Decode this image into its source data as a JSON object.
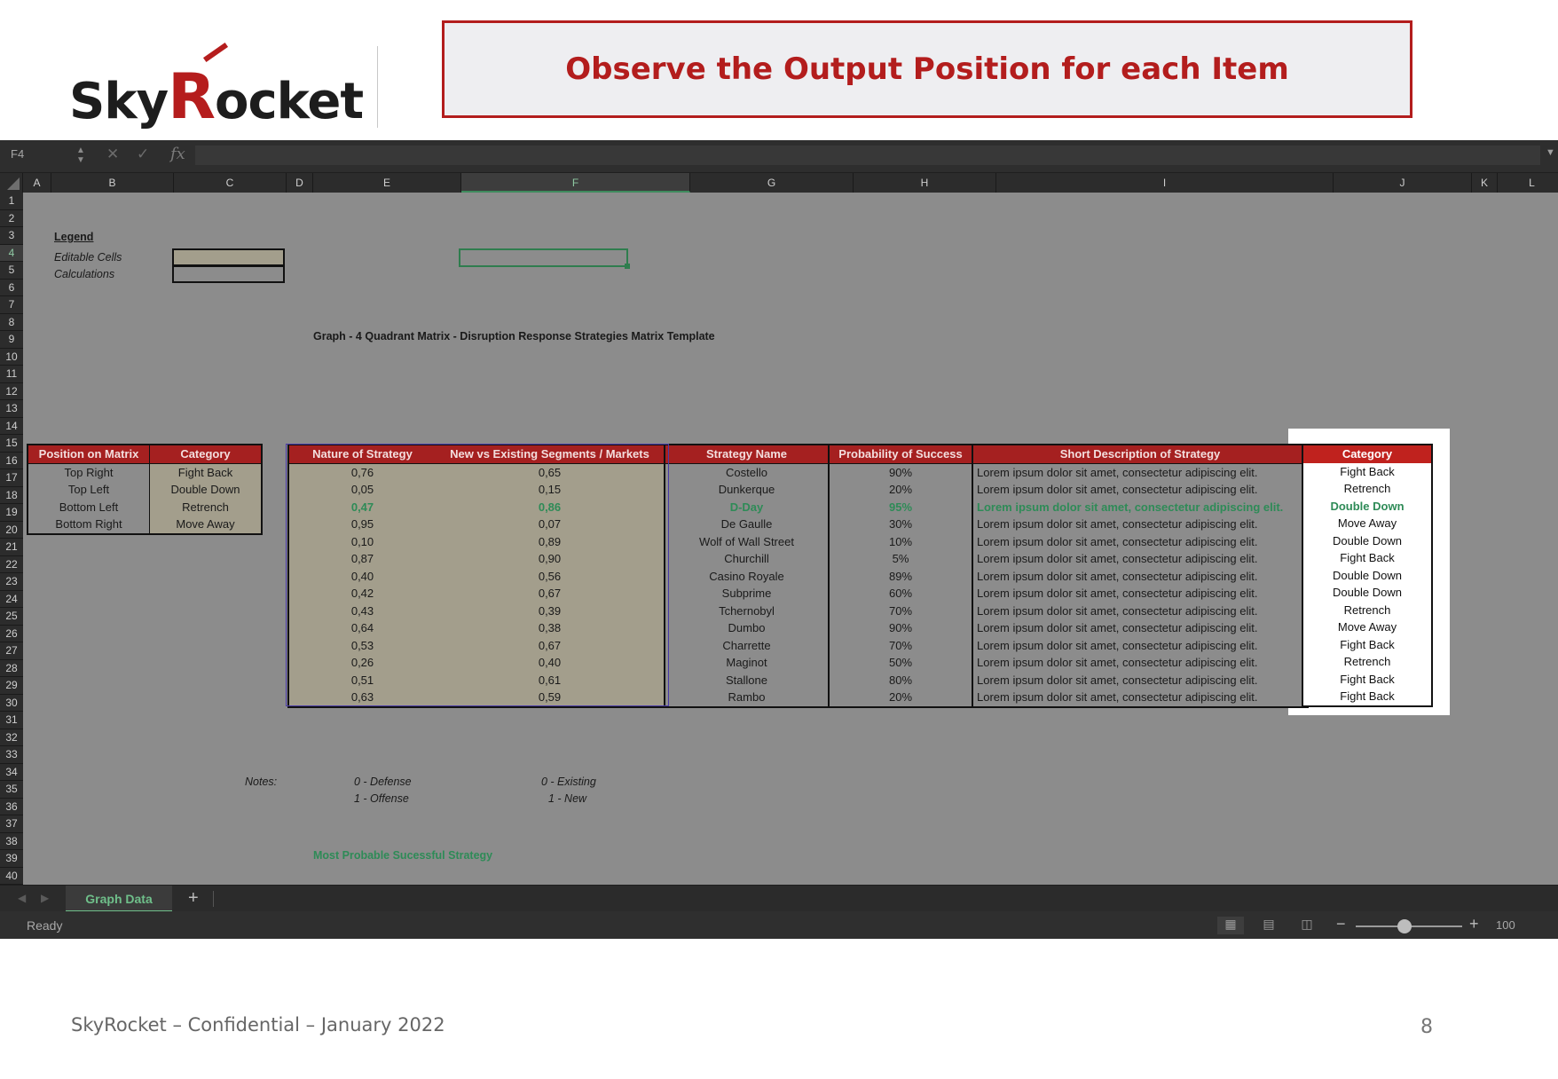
{
  "brand": {
    "logo_pre": "Sky",
    "logo_r": "R",
    "logo_post": "ocket"
  },
  "slide_title": "Observe the Output Position for each Item",
  "formula_bar": {
    "name_box": "F4",
    "fx": "fx",
    "formula": ""
  },
  "columns": [
    "A",
    "B",
    "C",
    "D",
    "E",
    "F",
    "G",
    "H",
    "I",
    "J",
    "K",
    "L"
  ],
  "selected_column": "F",
  "rows": [
    "1",
    "2",
    "3",
    "4",
    "5",
    "6",
    "7",
    "8",
    "9",
    "10",
    "11",
    "12",
    "13",
    "14",
    "15",
    "16",
    "17",
    "18",
    "19",
    "20",
    "21",
    "22",
    "23",
    "24",
    "25",
    "26",
    "27",
    "28",
    "29",
    "30",
    "31",
    "32",
    "33",
    "34",
    "35",
    "36",
    "37",
    "38",
    "39",
    "40"
  ],
  "selected_row": "4",
  "legend": {
    "title": "Legend",
    "editable": "Editable Cells",
    "calculations": "Calculations"
  },
  "subtitle": "Graph - 4 Quadrant Matrix  - Disruption Response Strategies Matrix Template",
  "legend_table": {
    "headers": [
      "Position on Matrix",
      "Category"
    ],
    "rows": [
      [
        "Top Right",
        "Fight Back"
      ],
      [
        "Top Left",
        "Double Down"
      ],
      [
        "Bottom Left",
        "Retrench"
      ],
      [
        "Bottom Right",
        "Move Away"
      ]
    ]
  },
  "main_table": {
    "headers": [
      "Nature of Strategy",
      "New vs Existing Segments / Markets",
      "Strategy Name",
      "Probability of Success",
      "Short Description of Strategy"
    ],
    "highlight_row": 2,
    "rows": [
      [
        "0,76",
        "0,65",
        "Costello",
        "90%",
        "Lorem ipsum dolor sit amet, consectetur adipiscing elit."
      ],
      [
        "0,05",
        "0,15",
        "Dunkerque",
        "20%",
        "Lorem ipsum dolor sit amet, consectetur adipiscing elit."
      ],
      [
        "0,47",
        "0,86",
        "D-Day",
        "95%",
        "Lorem ipsum dolor sit amet, consectetur adipiscing elit."
      ],
      [
        "0,95",
        "0,07",
        "De Gaulle",
        "30%",
        "Lorem ipsum dolor sit amet, consectetur adipiscing elit."
      ],
      [
        "0,10",
        "0,89",
        "Wolf of Wall Street",
        "10%",
        "Lorem ipsum dolor sit amet, consectetur adipiscing elit."
      ],
      [
        "0,87",
        "0,90",
        "Churchill",
        "5%",
        "Lorem ipsum dolor sit amet, consectetur adipiscing elit."
      ],
      [
        "0,40",
        "0,56",
        "Casino Royale",
        "89%",
        "Lorem ipsum dolor sit amet, consectetur adipiscing elit."
      ],
      [
        "0,42",
        "0,67",
        "Subprime",
        "60%",
        "Lorem ipsum dolor sit amet, consectetur adipiscing elit."
      ],
      [
        "0,43",
        "0,39",
        "Tchernobyl",
        "70%",
        "Lorem ipsum dolor sit amet, consectetur adipiscing elit."
      ],
      [
        "0,64",
        "0,38",
        "Dumbo",
        "90%",
        "Lorem ipsum dolor sit amet, consectetur adipiscing elit."
      ],
      [
        "0,53",
        "0,67",
        "Charrette",
        "70%",
        "Lorem ipsum dolor sit amet, consectetur adipiscing elit."
      ],
      [
        "0,26",
        "0,40",
        "Maginot",
        "50%",
        "Lorem ipsum dolor sit amet, consectetur adipiscing elit."
      ],
      [
        "0,51",
        "0,61",
        "Stallone",
        "80%",
        "Lorem ipsum dolor sit amet, consectetur adipiscing elit."
      ],
      [
        "0,63",
        "0,59",
        "Rambo",
        "20%",
        "Lorem ipsum dolor sit amet, consectetur adipiscing elit."
      ]
    ]
  },
  "output_table": {
    "header": "Category",
    "rows": [
      "Fight Back",
      "Retrench",
      "Double Down",
      "Move Away",
      "Double Down",
      "Fight Back",
      "Double Down",
      "Double Down",
      "Retrench",
      "Move Away",
      "Fight Back",
      "Retrench",
      "Fight Back",
      "Fight Back"
    ]
  },
  "notes": {
    "label": "Notes:",
    "e1": "0 - Defense",
    "e2": "1 - Offense",
    "f1": "0 - Existing",
    "f2": "1 - New"
  },
  "green_note": "Most Probable Sucessful Strategy",
  "sheet_tab": "Graph Data",
  "status": "Ready",
  "zoom": "100",
  "footer": "SkyRocket – Confidential – January 2022",
  "page_number": "8",
  "colors": {
    "brand_red": "#b31d1d",
    "highlight_green": "#2e8b57",
    "editable": "#a39e8c"
  }
}
